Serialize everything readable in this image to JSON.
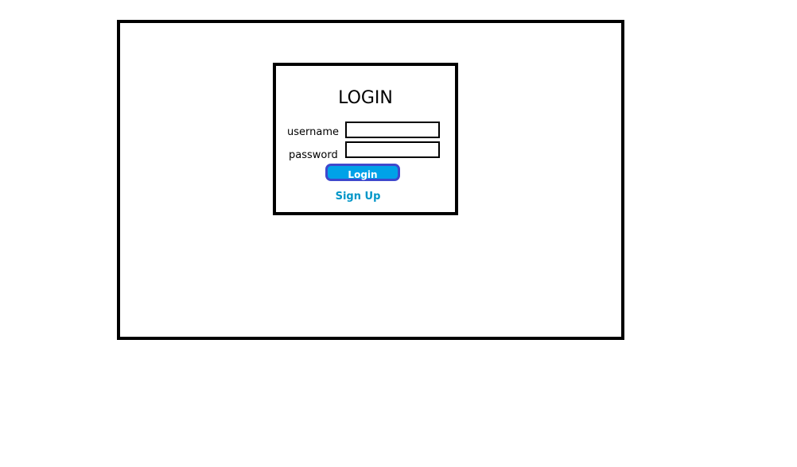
{
  "login": {
    "title": "LOGIN",
    "username_label": "username",
    "password_label": "password",
    "username_value": "",
    "password_value": "",
    "button_label": "Login",
    "signup_label": "Sign Up"
  },
  "colors": {
    "button_fill": "#00a2e8",
    "button_border": "#3f48cc",
    "link": "#0096c8"
  }
}
